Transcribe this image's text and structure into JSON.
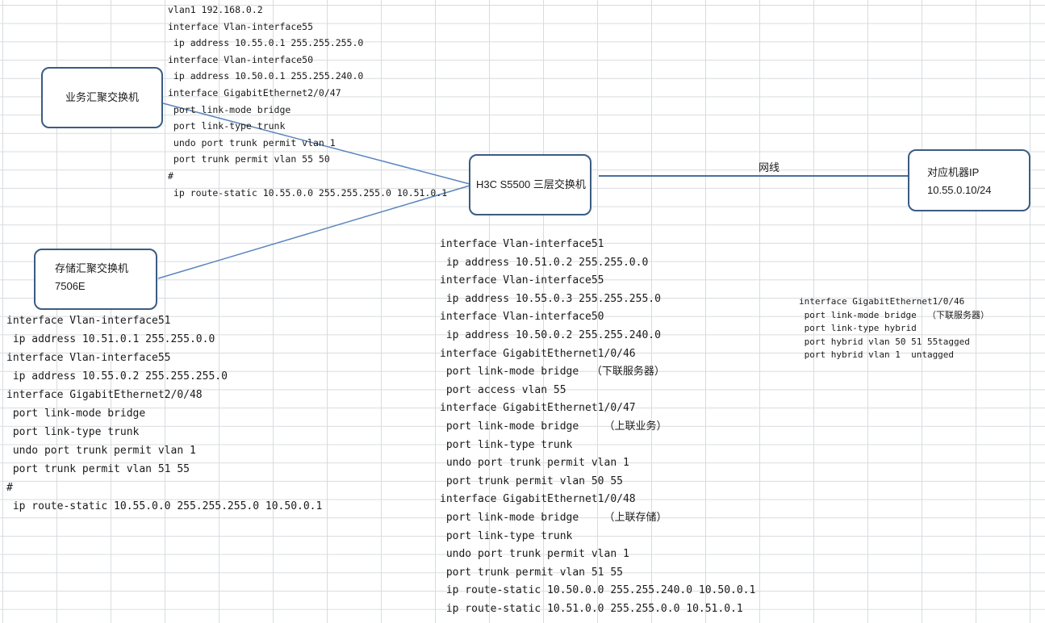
{
  "nodes": {
    "business_switch": {
      "label": "业务汇聚交换机"
    },
    "storage_switch": {
      "line1": "存储汇聚交换机",
      "line2": "7506E"
    },
    "core_switch": {
      "label": "H3C S5500 三层交换机"
    },
    "target_machine": {
      "line1": "对应机器IP",
      "line2": "10.55.0.10/24"
    }
  },
  "link_label": "网线",
  "config_business": [
    "vlan1 192.168.0.2",
    "interface Vlan-interface55",
    " ip address 10.55.0.1 255.255.255.0",
    "interface Vlan-interface50",
    " ip address 10.50.0.1 255.255.240.0",
    "interface GigabitEthernet2/0/47",
    " port link-mode bridge",
    " port link-type trunk",
    " undo port trunk permit vlan 1",
    " port trunk permit vlan 55 50",
    "#",
    " ip route-static 10.55.0.0 255.255.255.0 10.51.0.1"
  ],
  "config_storage": [
    "interface Vlan-interface51",
    " ip address 10.51.0.1 255.255.0.0",
    "interface Vlan-interface55",
    " ip address 10.55.0.2 255.255.255.0",
    "interface GigabitEthernet2/0/48",
    " port link-mode bridge",
    " port link-type trunk",
    " undo port trunk permit vlan 1",
    " port trunk permit vlan 51 55",
    "#",
    " ip route-static 10.55.0.0 255.255.255.0 10.50.0.1"
  ],
  "config_core": [
    "interface Vlan-interface51",
    " ip address 10.51.0.2 255.255.0.0",
    "interface Vlan-interface55",
    " ip address 10.55.0.3 255.255.255.0",
    "interface Vlan-interface50",
    " ip address 10.50.0.2 255.255.240.0",
    "interface GigabitEthernet1/0/46",
    " port link-mode bridge  （下联服务器）",
    " port access vlan 55",
    "interface GigabitEthernet1/0/47",
    " port link-mode bridge    （上联业务）",
    " port link-type trunk",
    " undo port trunk permit vlan 1",
    " port trunk permit vlan 50 55",
    "interface GigabitEthernet1/0/48",
    " port link-mode bridge    （上联存储）",
    " port link-type trunk",
    " undo port trunk permit vlan 1",
    " port trunk permit vlan 51 55",
    " ip route-static 10.50.0.0 255.255.240.0 10.50.0.1",
    " ip route-static 10.51.0.0 255.255.0.0 10.51.0.1"
  ],
  "config_hybrid": [
    "interface GigabitEthernet1/0/46",
    " port link-mode bridge  （下联服务器）",
    " port link-type hybrid",
    " port hybrid vlan 50 51 55tagged",
    " port hybrid vlan 1  untagged"
  ],
  "colors": {
    "node_border": "#3b5c82",
    "link_line": "#5b86bd",
    "grid_line": "#d8dcdf"
  }
}
